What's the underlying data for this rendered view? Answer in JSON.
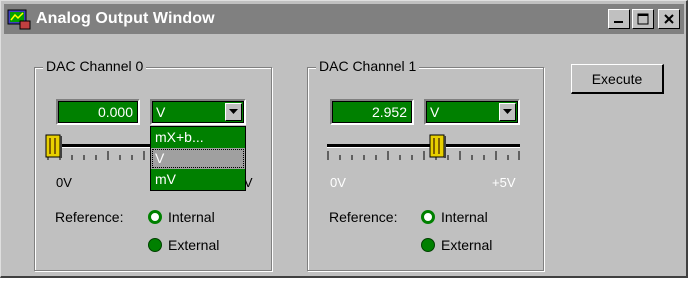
{
  "window": {
    "title": "Analog Output Window",
    "minimize_glyph": "_",
    "maximize_glyph": "□",
    "close_glyph": "✕"
  },
  "execute_label": "Execute",
  "channels": [
    {
      "group_label": "DAC Channel 0",
      "value": "0.000",
      "unit": "V",
      "slider_fraction": 0.0,
      "min_label": "0V",
      "max_label": "+5V",
      "reference_label": "Reference:",
      "options": {
        "internal": "Internal",
        "external": "External"
      },
      "reference_selected": "external",
      "dropdown_open": true,
      "dropdown_items": [
        "mX+b...",
        "V",
        "mV"
      ],
      "dropdown_selected": "V"
    },
    {
      "group_label": "DAC Channel 1",
      "value": "2.952",
      "unit": "V",
      "slider_fraction": 0.5904,
      "min_label": "0V",
      "max_label": "+5V",
      "reference_label": "Reference:",
      "options": {
        "internal": "Internal",
        "external": "External"
      },
      "reference_selected": "external"
    }
  ],
  "colors": {
    "window_bg": "#c0c0c0",
    "titlebar_bg": "#808080",
    "field_green": "#008000",
    "thumb_yellow": "#e8d000"
  }
}
